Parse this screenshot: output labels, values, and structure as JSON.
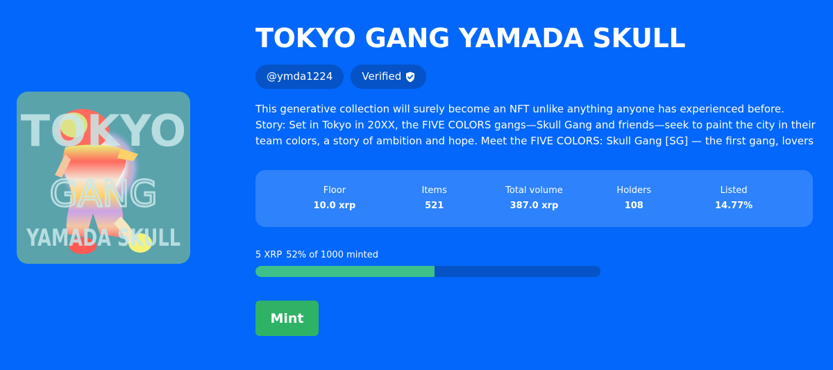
{
  "collection": {
    "artwork": {
      "text_line1": "TOKYO",
      "text_line2": "GANG",
      "text_line3": "YAMADA SKULL",
      "background_color": "#5aa3ab"
    },
    "title": "TOKYO GANG YAMADA SKULL",
    "creator_handle": "@ymda1224",
    "verified_label": "Verified",
    "description": "This generative collection will surely become an NFT unlike anything anyone has experienced before. Story: Set in Tokyo in 20XX, the FIVE COLORS gangs—Skull Gang and friends—seek to paint the city in their team colors, a story of ambition and hope. Meet the FIVE COLORS: Skull Gang [SG] — the first gang, lovers of..."
  },
  "stats": [
    {
      "label": "Floor",
      "value": "10.0 xrp"
    },
    {
      "label": "Items",
      "value": "521"
    },
    {
      "label": "Total volume",
      "value": "387.0 xrp"
    },
    {
      "label": "Holders",
      "value": "108"
    },
    {
      "label": "Listed",
      "value": "14.77%"
    }
  ],
  "mint": {
    "price": "5 XRP",
    "progress_text": "52% of 1000 minted",
    "progress_percent": 52,
    "button_label": "Mint"
  },
  "colors": {
    "background": "#0267fa",
    "badge": "#0553c6",
    "stats_panel": "#2e82fb",
    "progress_fill": "#3ec08a",
    "mint_button": "#2fb266"
  }
}
